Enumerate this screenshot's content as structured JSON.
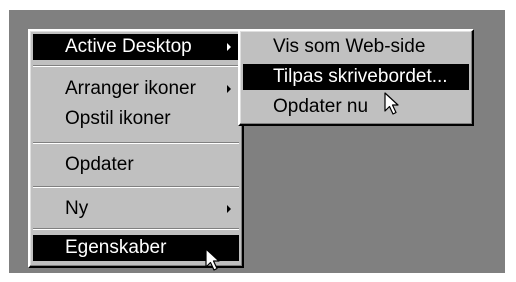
{
  "context_menu": {
    "items": [
      {
        "label": "Active Desktop",
        "has_submenu": true,
        "highlighted": true
      },
      {
        "label": "Arranger ikoner",
        "has_submenu": true,
        "highlighted": false
      },
      {
        "label": "Opstil ikoner",
        "has_submenu": false,
        "highlighted": false
      },
      {
        "label": "Opdater",
        "has_submenu": false,
        "highlighted": false
      },
      {
        "label": "Ny",
        "has_submenu": true,
        "highlighted": false
      },
      {
        "label": "Egenskaber",
        "has_submenu": false,
        "highlighted": true
      }
    ]
  },
  "submenu": {
    "items": [
      {
        "label": "Vis som Web-side",
        "highlighted": false
      },
      {
        "label": "Tilpas skrivebordet...",
        "highlighted": true
      },
      {
        "label": "Opdater nu",
        "highlighted": false
      }
    ]
  },
  "colors": {
    "menu_face": "#c0c0c0",
    "highlight_bg": "#000000",
    "highlight_text": "#ffffff",
    "desktop": "#808080"
  },
  "icons": [
    "submenu-arrow-icon",
    "mouse-pointer-icon"
  ]
}
